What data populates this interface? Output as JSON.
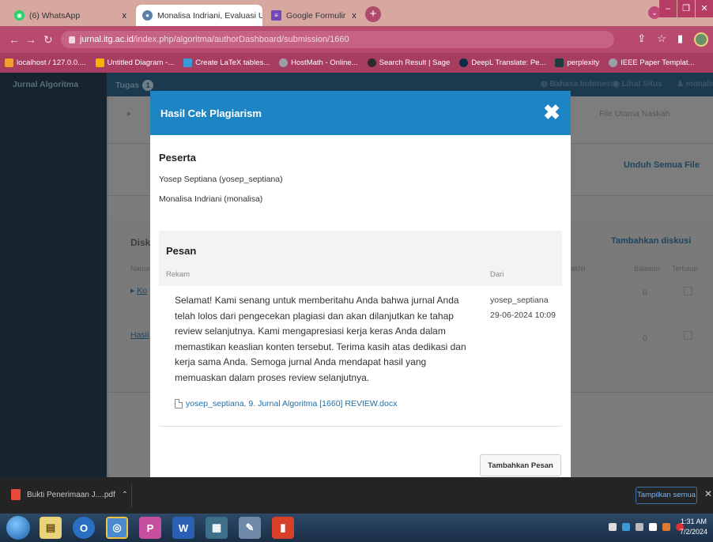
{
  "browser": {
    "tabs": [
      {
        "title": "(6) WhatsApp",
        "close": "x"
      },
      {
        "title": "Monalisa Indriani, Evaluasi Usabi",
        "close": "x"
      },
      {
        "title": "Google Formulir",
        "close": "x"
      }
    ],
    "new_tab": "+",
    "url_host": "jurnal.itg.ac.id",
    "url_path": "/index.php/algoritma/authorDashboard/submission/1660",
    "bookmarks": [
      {
        "label": "localhost / 127.0.0....",
        "color": "#f0a030"
      },
      {
        "label": "Untitled Diagram -...",
        "color": "#f5b400"
      },
      {
        "label": "Create LaTeX tables...",
        "color": "#3a9ad9"
      },
      {
        "label": "HostMath - Online...",
        "color": "#9aa0a6"
      },
      {
        "label": "Search Result | Sage",
        "color": "#2b2b2b"
      },
      {
        "label": "DeepL Translate: Pe...",
        "color": "#0f2b46"
      },
      {
        "label": "perplexity",
        "color": "#1f3b3b"
      },
      {
        "label": "IEEE Paper Templat...",
        "color": "#9aa0a6"
      }
    ]
  },
  "ojs": {
    "journal_name": "Jurnal Algoritma",
    "tasks_label": "Tugas",
    "tasks_count": "1",
    "language": "Bahasa Indonesia",
    "view_site": "Lihat Situs",
    "user": "monalisa",
    "bg_file_label": "File Utama Naskah",
    "bg_download_all": "Unduh Semua File",
    "bg_discussion": "Disk",
    "bg_add_discussion": "Tambahkan diskusi",
    "bg_col_name": "Nama",
    "bg_col_last": "akhir",
    "bg_col_replies": "Balasan",
    "bg_col_closed": "Tertutup",
    "bg_row1": "Ko",
    "bg_row1_count": "0",
    "bg_row2": "Hasil",
    "bg_row2_count": "0"
  },
  "modal": {
    "title": "Hasil Cek Plagiarism",
    "participants_title": "Peserta",
    "participants": [
      "Yosep Septiana (yosep_septiana)",
      "Monalisa Indriani (monalisa)"
    ],
    "messages_title": "Pesan",
    "col_record": "Rekam",
    "col_from": "Dari",
    "message_text": "Selamat! Kami senang untuk memberitahu Anda bahwa jurnal Anda telah lolos dari pengecekan plagiasi dan akan dilanjutkan ke tahap review selanjutnya. Kami mengapresiasi kerja keras Anda dalam memastikan keaslian konten tersebut. Terima kasih atas dedikasi dan kerja sama Anda. Semoga jurnal Anda mendapat hasil yang memuaskan dalam proses review selanjutnya.",
    "message_from": "yosep_septiana",
    "message_date": "29-06-2024 10:09",
    "attachment": "yosep_septiana, 9. Jurnal Algoritma [1660] REVIEW.docx",
    "add_message": "Tambahkan Pesan"
  },
  "downloads": {
    "file": "Bukti Penerimaan J....pdf",
    "show_all": "Tampilkan semua",
    "close": "x"
  },
  "taskbar": {
    "time": "1:31 AM",
    "date": "7/2/2024"
  }
}
